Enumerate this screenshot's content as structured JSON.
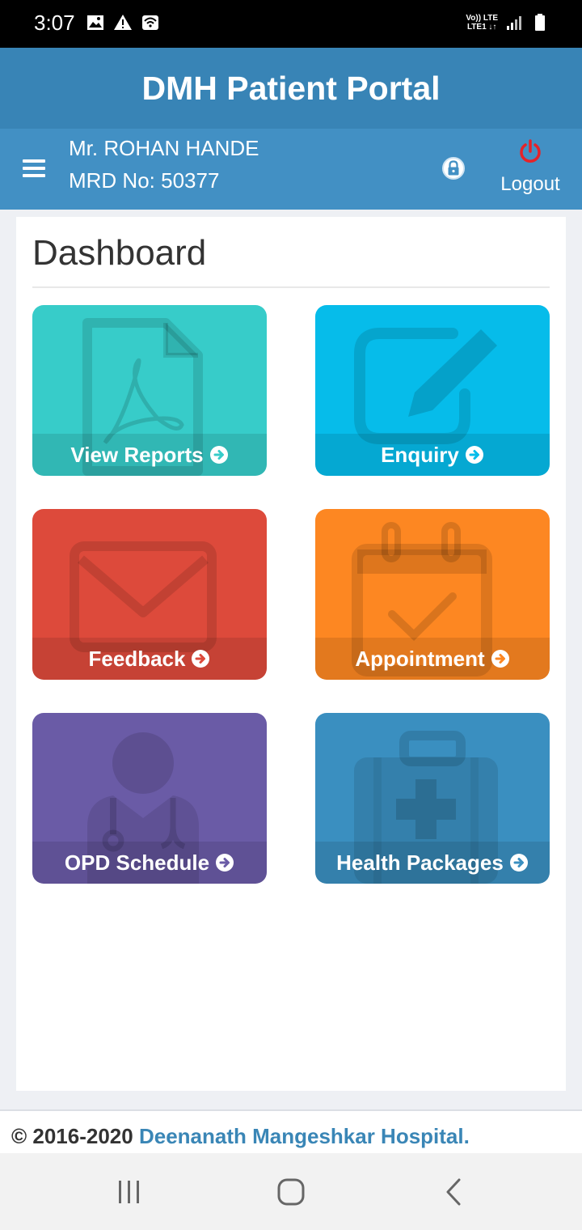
{
  "status_bar": {
    "time": "3:07",
    "network_label_top": "Vo)) LTE",
    "network_label_bottom": "LTE1 ↓↑"
  },
  "header": {
    "title": "DMH Patient Portal"
  },
  "user": {
    "name": "Mr. ROHAN HANDE",
    "mrd": "MRD No: 50377",
    "logout_label": "Logout"
  },
  "dashboard": {
    "title": "Dashboard",
    "tiles": [
      {
        "label": "View Reports",
        "color": "#37ccc9",
        "icon": "pdf-document-icon"
      },
      {
        "label": "Enquiry",
        "color": "#06bcea",
        "icon": "edit-icon"
      },
      {
        "label": "Feedback",
        "color": "#dd4a3b",
        "icon": "envelope-icon"
      },
      {
        "label": "Appointment",
        "color": "#fd8722",
        "icon": "calendar-check-icon"
      },
      {
        "label": "OPD Schedule",
        "color": "#6a5ba6",
        "icon": "doctor-icon"
      },
      {
        "label": "Health Packages",
        "color": "#3a8fc0",
        "icon": "medical-kit-icon"
      }
    ]
  },
  "footer": {
    "copyright": "© 2016-2020",
    "hospital": "Deenanath Mangeshkar Hospital."
  },
  "colors": {
    "header_bg": "#3884b6",
    "userbar_bg": "#4290c4",
    "logout_icon": "#e5232a",
    "link": "#3a86b6"
  }
}
